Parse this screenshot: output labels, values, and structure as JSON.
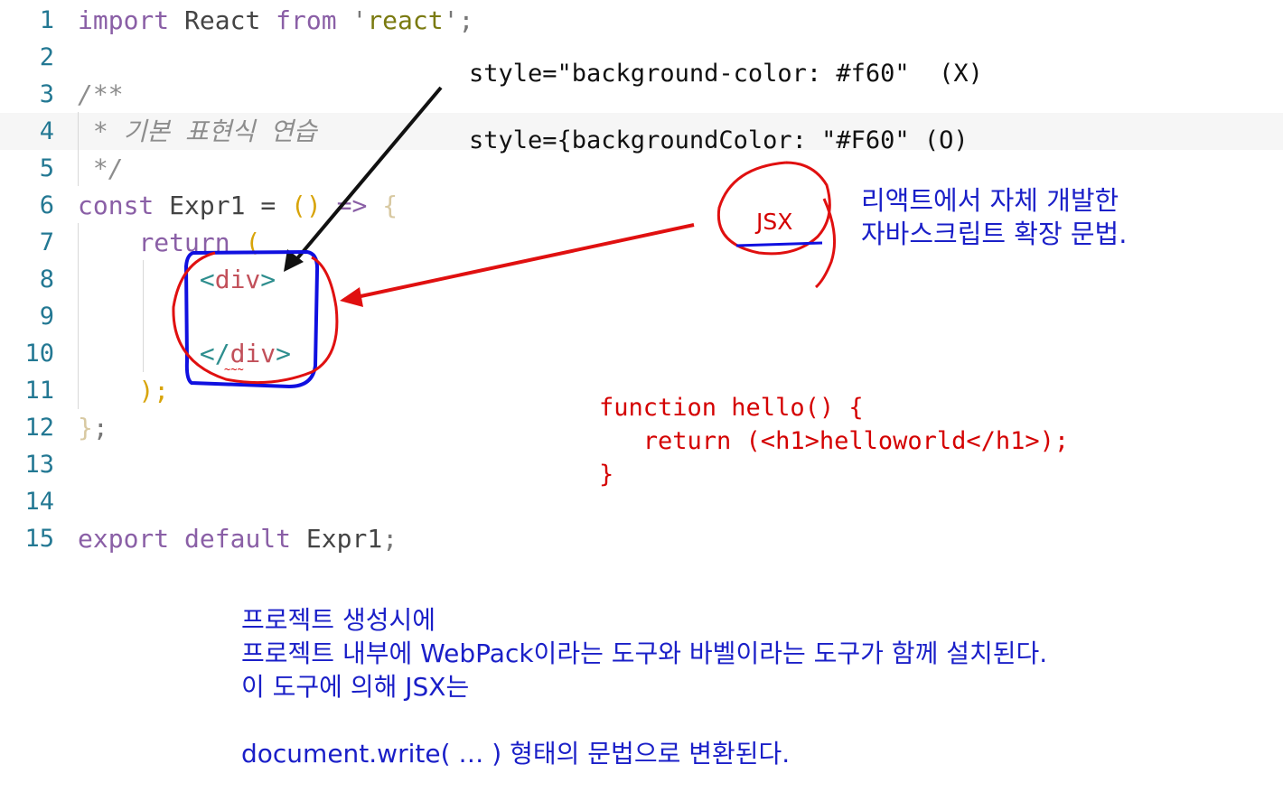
{
  "editor": {
    "lines": [
      {
        "num": "1",
        "tokens": [
          {
            "t": "import",
            "c": "kw"
          },
          {
            "t": " React ",
            "c": "id"
          },
          {
            "t": "from",
            "c": "kw"
          },
          {
            "t": " '",
            "c": "punct"
          },
          {
            "t": "react",
            "c": "str"
          },
          {
            "t": "'",
            "c": "punct"
          },
          {
            "t": ";",
            "c": "punct"
          }
        ]
      },
      {
        "num": "2",
        "tokens": []
      },
      {
        "num": "3",
        "tokens": [
          {
            "t": "/**",
            "c": "cmt"
          }
        ]
      },
      {
        "num": "4",
        "tokens": [
          {
            "t": " * 기본 표현식 연습",
            "c": "cmt"
          }
        ]
      },
      {
        "num": "5",
        "tokens": [
          {
            "t": " */",
            "c": "cmt"
          }
        ]
      },
      {
        "num": "6",
        "tokens": [
          {
            "t": "const",
            "c": "kw"
          },
          {
            "t": " Expr1 ",
            "c": "id"
          },
          {
            "t": "=",
            "c": "op"
          },
          {
            "t": " ",
            "c": "op"
          },
          {
            "t": "()",
            "c": "paren"
          },
          {
            "t": " => ",
            "c": "kw"
          },
          {
            "t": "{",
            "c": "brace"
          }
        ]
      },
      {
        "num": "7",
        "tokens": [
          {
            "t": "    ",
            "c": "op"
          },
          {
            "t": "return",
            "c": "kw"
          },
          {
            "t": " (",
            "c": "paren"
          }
        ]
      },
      {
        "num": "8",
        "tokens": [
          {
            "t": "        ",
            "c": "op"
          },
          {
            "t": "<",
            "c": "tagb"
          },
          {
            "t": "div",
            "c": "tag"
          },
          {
            "t": ">",
            "c": "tagb"
          }
        ]
      },
      {
        "num": "9",
        "tokens": []
      },
      {
        "num": "10",
        "tokens": [
          {
            "t": "        ",
            "c": "op"
          },
          {
            "t": "</",
            "c": "tagb"
          },
          {
            "t": "div",
            "c": "tag"
          },
          {
            "t": ">",
            "c": "tagb"
          }
        ]
      },
      {
        "num": "11",
        "tokens": [
          {
            "t": "    ",
            "c": "op"
          },
          {
            "t": ");",
            "c": "paren"
          }
        ]
      },
      {
        "num": "12",
        "tokens": [
          {
            "t": "}",
            "c": "brace"
          },
          {
            "t": ";",
            "c": "punct"
          }
        ]
      },
      {
        "num": "13",
        "tokens": []
      },
      {
        "num": "14",
        "tokens": []
      },
      {
        "num": "15",
        "tokens": [
          {
            "t": "export",
            "c": "kw"
          },
          {
            "t": " ",
            "c": "op"
          },
          {
            "t": "default",
            "c": "kw"
          },
          {
            "t": " Expr1",
            "c": "id"
          },
          {
            "t": ";",
            "c": "punct"
          }
        ]
      }
    ],
    "active_line": "4"
  },
  "annotations": {
    "style_wrong": "style=\"background-color: #f60\"  (X)",
    "style_right": "style={backgroundColor: \"#F60\" (O)",
    "jsx_label": "JSX",
    "jsx_desc_1": "리액트에서 자체 개발한",
    "jsx_desc_2": "자바스크립트 확장 문법.",
    "example_1": "function hello() {",
    "example_2": "   return (<h1>helloworld</h1>);",
    "example_3": "}",
    "bottom_1": "프로젝트 생성시에",
    "bottom_2": "프로젝트 내부에 WebPack이라는 도구와 바벨이라는 도구가 함께 설치된다.",
    "bottom_3": "이 도구에 의해 JSX는",
    "bottom_4": "document.write( … ) 형태의 문법으로 변환된다."
  },
  "colors": {
    "annotation_red": "#d40000",
    "annotation_blue": "#1a1fc8",
    "arrow_black": "#111111",
    "line_number": "#237893"
  }
}
